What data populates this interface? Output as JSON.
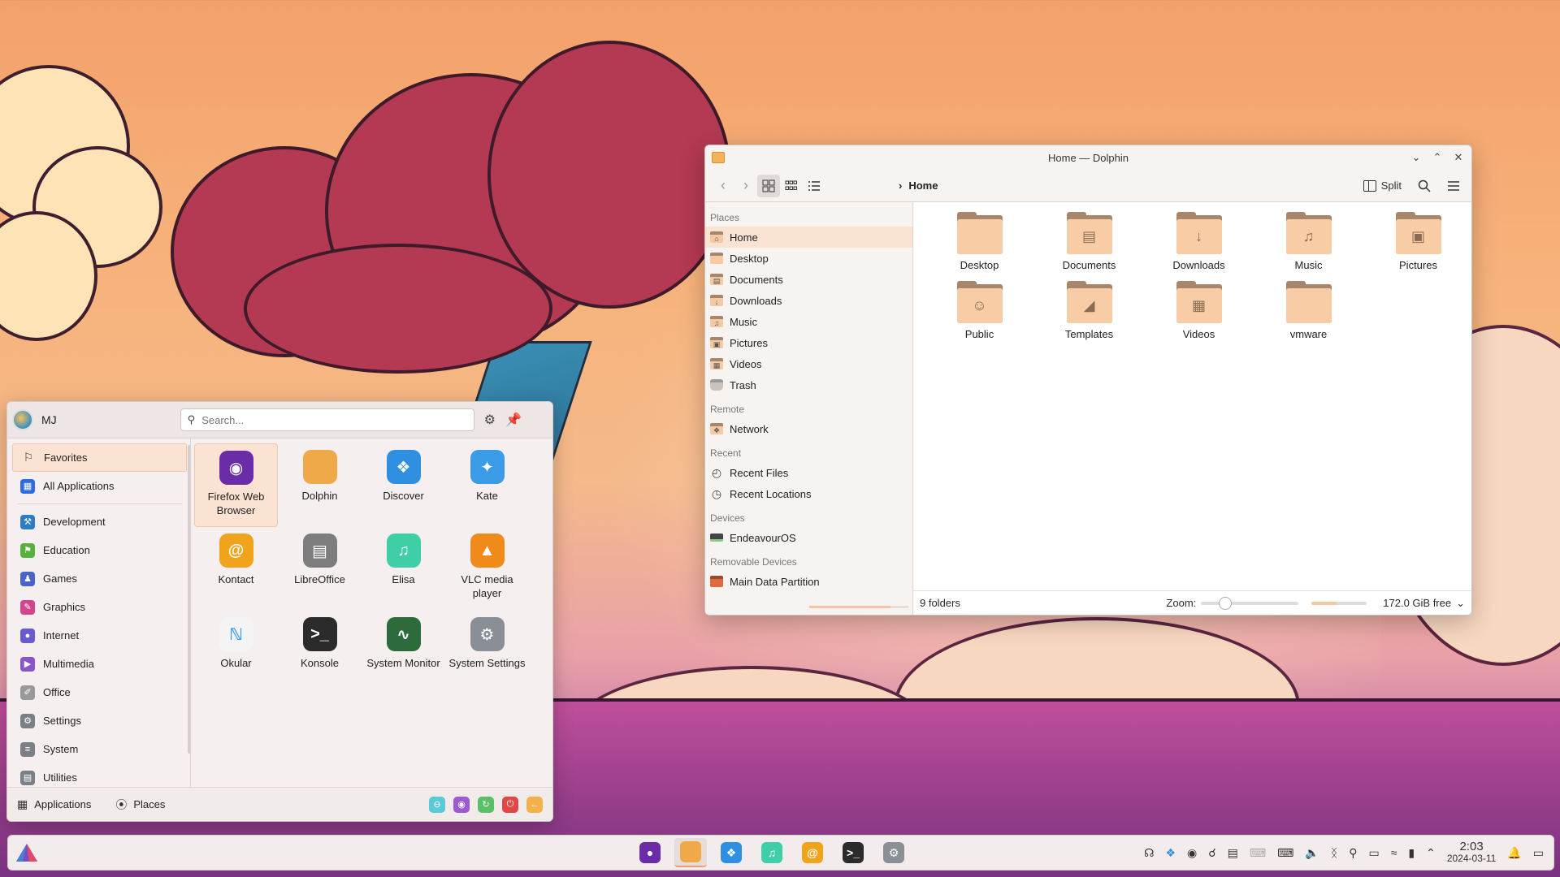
{
  "dolphin": {
    "title": "Home — Dolphin",
    "breadcrumb": "Home",
    "split_label": "Split",
    "places_sections": {
      "places": "Places",
      "remote": "Remote",
      "recent": "Recent",
      "devices": "Devices",
      "removable": "Removable Devices"
    },
    "places": [
      "Home",
      "Desktop",
      "Documents",
      "Downloads",
      "Music",
      "Pictures",
      "Videos",
      "Trash"
    ],
    "remote": [
      "Network"
    ],
    "recent": [
      "Recent Files",
      "Recent Locations"
    ],
    "devices": [
      "EndeavourOS"
    ],
    "removable": [
      "Main Data Partition"
    ],
    "folders": [
      "Desktop",
      "Documents",
      "Downloads",
      "Music",
      "Pictures",
      "Public",
      "Templates",
      "Videos",
      "vmware"
    ],
    "status_left": "9 folders",
    "zoom_label": "Zoom:",
    "free_space": "172.0 GiB free",
    "device_usage_fraction": 0.82,
    "disk_used_fraction": 0.45
  },
  "launcher": {
    "user": "MJ",
    "search_placeholder": "Search...",
    "categories": [
      "Favorites",
      "All Applications",
      "Development",
      "Education",
      "Games",
      "Graphics",
      "Internet",
      "Multimedia",
      "Office",
      "Settings",
      "System",
      "Utilities"
    ],
    "apps": [
      {
        "label": "Firefox Web Browser",
        "color": "#6b2ca8"
      },
      {
        "label": "Dolphin",
        "color": "#f0a948"
      },
      {
        "label": "Discover",
        "color": "#2f8fe0"
      },
      {
        "label": "Kate",
        "color": "#3a9be6"
      },
      {
        "label": "Kontact",
        "color": "#f2a31c"
      },
      {
        "label": "LibreOffice",
        "color": "#7d7d7d"
      },
      {
        "label": "Elisa",
        "color": "#3fcfa6"
      },
      {
        "label": "VLC media player",
        "color": "#f08a1a"
      },
      {
        "label": "Okular",
        "color": "#f4f4f4"
      },
      {
        "label": "Konsole",
        "color": "#2b2b2b"
      },
      {
        "label": "System Monitor",
        "color": "#2d6b3c"
      },
      {
        "label": "System Settings",
        "color": "#8a8f96"
      }
    ],
    "footer_tabs": [
      "Applications",
      "Places"
    ]
  },
  "taskbar": {
    "time": "2:03",
    "date": "2024-03-11"
  }
}
